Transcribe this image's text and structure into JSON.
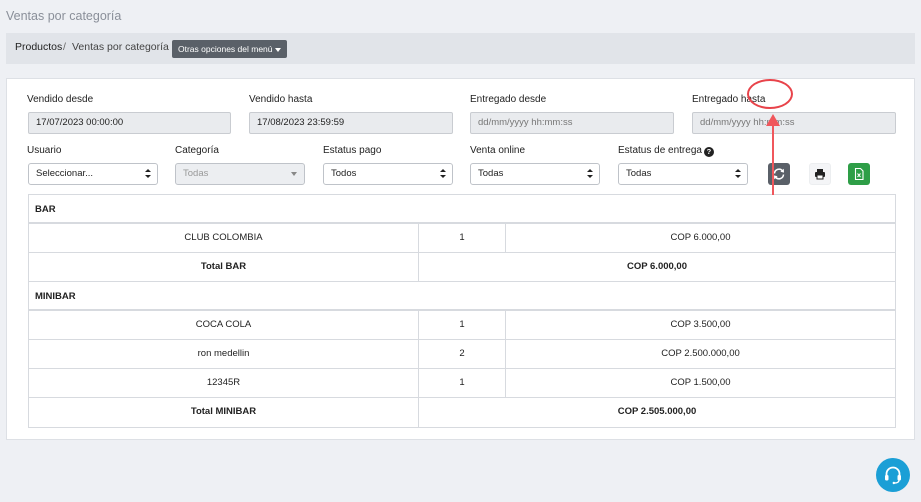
{
  "page": {
    "title": "Ventas por categoría"
  },
  "breadcrumb": {
    "first": "Productos",
    "separator": "/",
    "current": "Ventas por categoría",
    "options_label": "Otras opciones del menú"
  },
  "filters": {
    "vendido_desde": {
      "label": "Vendido desde",
      "value": "17/07/2023 00:00:00"
    },
    "vendido_hasta": {
      "label": "Vendido hasta",
      "value": "17/08/2023 23:59:59"
    },
    "entregado_desde": {
      "label": "Entregado desde",
      "placeholder": "dd/mm/yyyy hh:mm:ss"
    },
    "entregado_hasta": {
      "label": "Entregado hasta",
      "placeholder": "dd/mm/yyyy hh:mm:ss"
    },
    "usuario": {
      "label": "Usuario",
      "value": "Seleccionar..."
    },
    "categoria": {
      "label": "Categoría",
      "value": "Todas"
    },
    "estatus_pago": {
      "label": "Estatus pago",
      "value": "Todos"
    },
    "venta_online": {
      "label": "Venta online",
      "value": "Todas"
    },
    "estatus_entrega": {
      "label": "Estatus de entrega",
      "value": "Todas"
    }
  },
  "toolbar": {
    "refresh_icon": "refresh-icon",
    "print_icon": "printer-icon",
    "excel_icon": "excel-file-icon",
    "refresh_color": "#5a6068",
    "excel_color": "#2e9e47",
    "highlight_color": "#e8434a"
  },
  "report": {
    "groups": [
      {
        "name": "BAR",
        "rows": [
          {
            "product": "CLUB COLOMBIA",
            "qty": "1",
            "amount": "COP 6.000,00"
          }
        ],
        "total_label": "Total BAR",
        "total_amount": "COP 6.000,00"
      },
      {
        "name": "MINIBAR",
        "rows": [
          {
            "product": "COCA COLA",
            "qty": "1",
            "amount": "COP 3.500,00"
          },
          {
            "product": "ron medellin",
            "qty": "2",
            "amount": "COP 2.500.000,00"
          },
          {
            "product": "12345R",
            "qty": "1",
            "amount": "COP 1.500,00"
          }
        ],
        "total_label": "Total MINIBAR",
        "total_amount": "COP 2.505.000,00"
      }
    ]
  },
  "support": {
    "icon": "headset-icon",
    "color": "#1b9fd6"
  }
}
